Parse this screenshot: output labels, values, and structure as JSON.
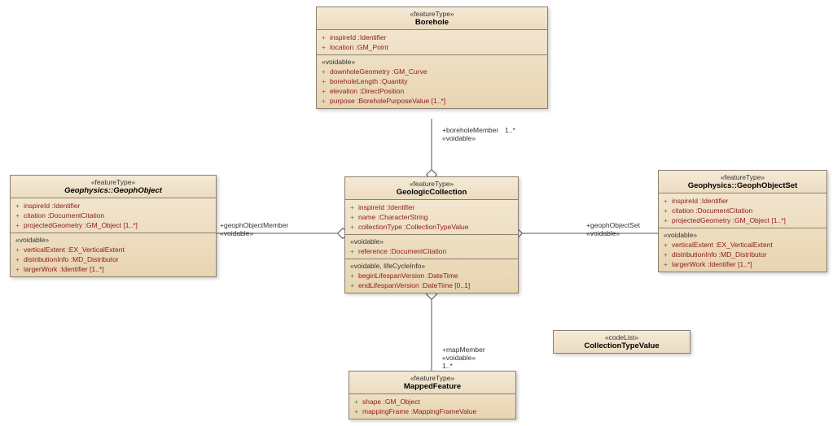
{
  "chart_data": {
    "type": "uml_class_diagram",
    "classes": [
      {
        "id": "Borehole",
        "stereotype": "«featureType»",
        "name": "Borehole",
        "compartments": [
          {
            "attrs": [
              {
                "name": "inspireId",
                "type": "Identifier"
              },
              {
                "name": "location",
                "type": "GM_Point"
              }
            ]
          },
          {
            "stereotype": "«voidable»",
            "attrs": [
              {
                "name": "downholeGeometry",
                "type": "GM_Curve"
              },
              {
                "name": "boreholeLength",
                "type": "Quantity"
              },
              {
                "name": "elevation",
                "type": "DirectPosition"
              },
              {
                "name": "purpose",
                "type": "BoreholePurposeValue [1..*]"
              }
            ]
          }
        ]
      },
      {
        "id": "GeophObject",
        "stereotype": "«featureType»",
        "name": "Geophysics::GeophObject",
        "italic": true,
        "compartments": [
          {
            "attrs": [
              {
                "name": "inspireId",
                "type": "Identifier"
              },
              {
                "name": "citation",
                "type": "DocumentCitation"
              },
              {
                "name": "projectedGeometry",
                "type": "GM_Object [1..*]"
              }
            ]
          },
          {
            "stereotype": "«voidable»",
            "attrs": [
              {
                "name": "verticalExtent",
                "type": "EX_VerticalExtent"
              },
              {
                "name": "distributionInfo",
                "type": "MD_Distributor"
              },
              {
                "name": "largerWork",
                "type": "Identifier [1..*]"
              }
            ]
          }
        ]
      },
      {
        "id": "GeologicCollection",
        "stereotype": "«featureType»",
        "name": "GeologicCollection",
        "compartments": [
          {
            "attrs": [
              {
                "name": "inspireId",
                "type": "Identifier"
              },
              {
                "name": "name",
                "type": "CharacterString"
              },
              {
                "name": "collectionType",
                "type": "CollectionTypeValue"
              }
            ]
          },
          {
            "stereotype": "«voidable»",
            "attrs": [
              {
                "name": "reference",
                "type": "DocumentCitation"
              }
            ]
          },
          {
            "stereotype": "«voidable, lifeCycleInfo»",
            "attrs": [
              {
                "name": "beginLifespanVersion",
                "type": "DateTime"
              },
              {
                "name": "endLifespanVersion",
                "type": "DateTime [0..1]"
              }
            ]
          }
        ]
      },
      {
        "id": "GeophObjectSet",
        "stereotype": "«featureType»",
        "name": "Geophysics::GeophObjectSet",
        "compartments": [
          {
            "attrs": [
              {
                "name": "inspireId",
                "type": "Identifier"
              },
              {
                "name": "citation",
                "type": "DocumentCitation"
              },
              {
                "name": "projectedGeometry",
                "type": "GM_Object [1..*]"
              }
            ]
          },
          {
            "stereotype": "«voidable»",
            "attrs": [
              {
                "name": "verticalExtent",
                "type": "EX_VerticalExtent"
              },
              {
                "name": "distributionInfo",
                "type": "MD_Distributor"
              },
              {
                "name": "largerWork",
                "type": "Identifier [1..*]"
              }
            ]
          }
        ]
      },
      {
        "id": "MappedFeature",
        "stereotype": "«featureType»",
        "name": "MappedFeature",
        "compartments": [
          {
            "attrs": [
              {
                "name": "shape",
                "type": "GM_Object"
              },
              {
                "name": "mappingFrame",
                "type": "MappingFrameValue"
              }
            ]
          }
        ]
      },
      {
        "id": "CollectionTypeValue",
        "stereotype": "«codeList»",
        "name": "CollectionTypeValue",
        "compartments": []
      }
    ],
    "associations": [
      {
        "from": "GeologicCollection",
        "to": "Borehole",
        "type": "aggregation",
        "role": "+boreholeMember",
        "stereo": "«voidable»",
        "mult": "1..*"
      },
      {
        "from": "GeologicCollection",
        "to": "GeophObject",
        "type": "aggregation",
        "role": "+geophObjectMember",
        "stereo": "«voidable»"
      },
      {
        "from": "GeologicCollection",
        "to": "GeophObjectSet",
        "type": "aggregation",
        "role": "+geophObjectSet",
        "stereo": "«voidable»"
      },
      {
        "from": "GeologicCollection",
        "to": "MappedFeature",
        "type": "aggregation",
        "role": "+mapMember",
        "stereo": "«voidable»",
        "mult": "1..*"
      }
    ]
  },
  "labels": {
    "borehole_role": "+boreholeMember",
    "borehole_stereo": "«voidable»",
    "borehole_mult": "1..*",
    "geoph_role": "+geophObjectMember",
    "geoph_stereo": "«voidable»",
    "geophset_role": "+geophObjectSet",
    "geophset_stereo": "«voidable»",
    "map_role": "+mapMember",
    "map_stereo": "«voidable»",
    "map_mult": "1..*"
  }
}
